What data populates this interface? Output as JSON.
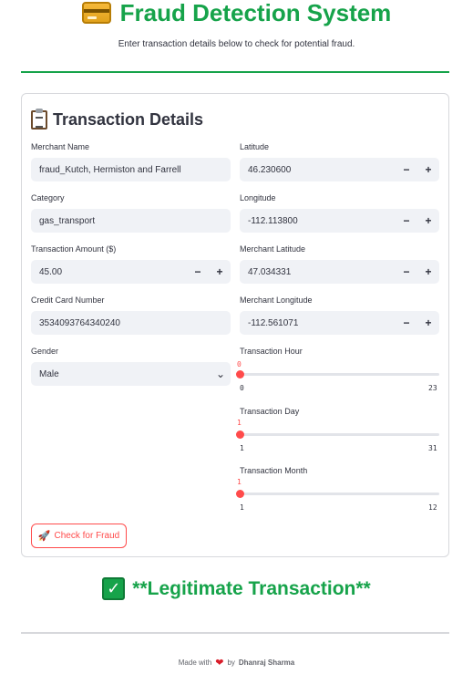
{
  "header": {
    "title": "Fraud Detection System",
    "subtitle": "Enter transaction details below to check for potential fraud."
  },
  "form": {
    "section_title": "Transaction Details",
    "merchant_name": {
      "label": "Merchant Name",
      "value": "fraud_Kutch, Hermiston and Farrell"
    },
    "category": {
      "label": "Category",
      "value": "gas_transport"
    },
    "amount": {
      "label": "Transaction Amount ($)",
      "value": "45.00"
    },
    "card_number": {
      "label": "Credit Card Number",
      "value": "3534093764340240"
    },
    "gender": {
      "label": "Gender",
      "value": "Male"
    },
    "latitude": {
      "label": "Latitude",
      "value": "46.230600"
    },
    "longitude": {
      "label": "Longitude",
      "value": "-112.113800"
    },
    "merchant_latitude": {
      "label": "Merchant Latitude",
      "value": "47.034331"
    },
    "merchant_longitude": {
      "label": "Merchant Longitude",
      "value": "-112.561071"
    },
    "hour": {
      "label": "Transaction Hour",
      "value": "0",
      "min": "0",
      "max": "23"
    },
    "day": {
      "label": "Transaction Day",
      "value": "1",
      "min": "1",
      "max": "31"
    },
    "month": {
      "label": "Transaction Month",
      "value": "1",
      "min": "1",
      "max": "12"
    },
    "stepper_minus": "−",
    "stepper_plus": "+",
    "submit_label": "Check for Fraud"
  },
  "result": {
    "text": "**Legitimate Transaction**",
    "check_glyph": "✓"
  },
  "footer": {
    "made_with": "Made with",
    "by": "by",
    "author": "Dhanraj Sharma",
    "heart_glyph": "❤"
  },
  "colors": {
    "accent_green": "#16a34a",
    "accent_red": "#ff4b4b"
  },
  "icons": {
    "title": "credit-card-icon",
    "section": "clipboard-icon",
    "button": "rocket-icon",
    "result": "check-mark-icon",
    "footer": "heart-icon"
  }
}
